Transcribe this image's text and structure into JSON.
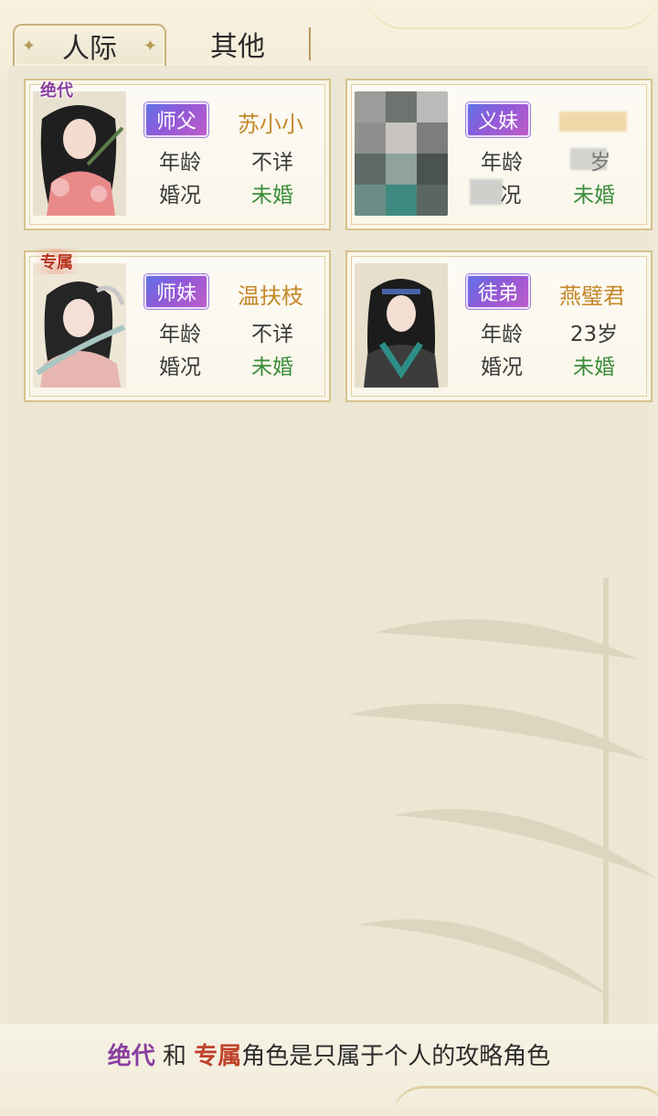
{
  "tabs": [
    {
      "label": "人际",
      "active": true
    },
    {
      "label": "其他",
      "active": false
    }
  ],
  "cards": [
    {
      "badge": "绝代",
      "relation": "师父",
      "name": "苏小小",
      "age_label": "年龄",
      "age": "不详",
      "marriage_label": "婚况",
      "marriage": "未婚",
      "blurred": false
    },
    {
      "badge": "",
      "relation": "义妹",
      "name": "",
      "age_label": "年龄",
      "age": "岁",
      "marriage_label": "况",
      "marriage": "未婚",
      "blurred": true
    },
    {
      "badge": "专属",
      "relation": "师妹",
      "name": "温扶枝",
      "age_label": "年龄",
      "age": "不详",
      "marriage_label": "婚况",
      "marriage": "未婚",
      "blurred": false
    },
    {
      "badge": "",
      "relation": "徒弟",
      "name": "燕璧君",
      "age_label": "年龄",
      "age": "23岁",
      "marriage_label": "婚况",
      "marriage": "未婚",
      "blurred": false
    }
  ],
  "footer": {
    "juedai": "绝代",
    "and": "和",
    "zhuanshu": "专属",
    "text": "角色是只属于个人的攻略角色"
  },
  "colors": {
    "name": "#c4882a",
    "marriage": "#3a8d3a",
    "relation_gradient_start": "#5d74e8",
    "relation_gradient_end": "#c25cc8"
  }
}
